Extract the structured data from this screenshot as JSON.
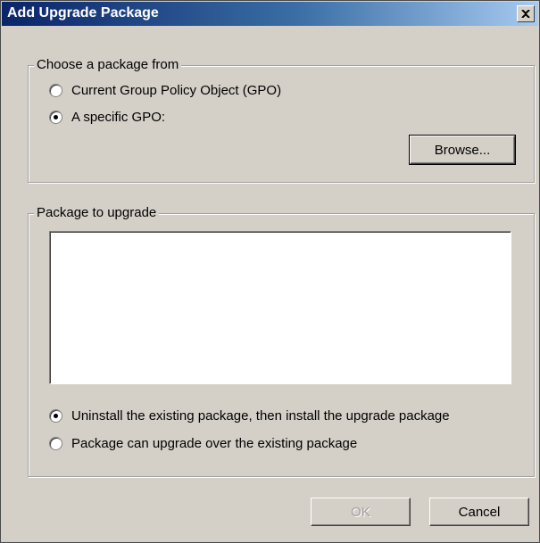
{
  "window": {
    "title": "Add Upgrade Package",
    "close_label": "✕"
  },
  "source_group": {
    "legend": "Choose a package from",
    "options": [
      {
        "label": "Current Group Policy Object (GPO)",
        "checked": false
      },
      {
        "label": "A specific GPO:",
        "checked": true
      }
    ],
    "browse_label": "Browse..."
  },
  "package_group": {
    "legend": "Package to upgrade",
    "options": [
      {
        "label": "Uninstall the existing package, then install the upgrade package",
        "checked": true
      },
      {
        "label": "Package can upgrade over the existing package",
        "checked": false
      }
    ]
  },
  "footer": {
    "ok_label": "OK",
    "cancel_label": "Cancel"
  }
}
